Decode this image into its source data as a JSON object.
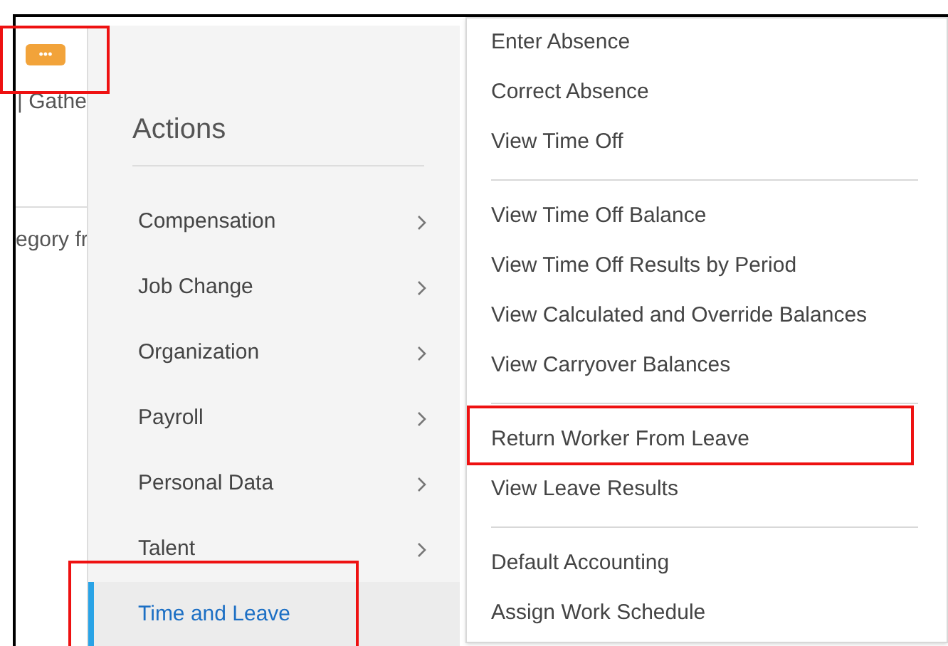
{
  "background": {
    "fragments": [
      "| Gathe",
      "egory fr"
    ]
  },
  "actions_button": {
    "label": "•••",
    "annotated": true
  },
  "actions_menu": {
    "title": "Actions",
    "items": [
      {
        "label": "Compensation",
        "selected": false,
        "annotated": false
      },
      {
        "label": "Job Change",
        "selected": false,
        "annotated": false
      },
      {
        "label": "Organization",
        "selected": false,
        "annotated": false
      },
      {
        "label": "Payroll",
        "selected": false,
        "annotated": false
      },
      {
        "label": "Personal Data",
        "selected": false,
        "annotated": false
      },
      {
        "label": "Talent",
        "selected": false,
        "annotated": false
      },
      {
        "label": "Time and Leave",
        "selected": true,
        "annotated": true
      }
    ]
  },
  "submenu": {
    "groups": [
      {
        "items": [
          {
            "label": "Enter Absence",
            "annotated": false
          },
          {
            "label": "Correct Absence",
            "annotated": false
          },
          {
            "label": "View Time Off",
            "annotated": false
          }
        ]
      },
      {
        "items": [
          {
            "label": "View Time Off Balance",
            "annotated": false
          },
          {
            "label": "View Time Off Results by Period",
            "annotated": false
          },
          {
            "label": "View Calculated and Override Balances",
            "annotated": false
          },
          {
            "label": "View Carryover Balances",
            "annotated": false
          }
        ]
      },
      {
        "items": [
          {
            "label": "Return Worker From Leave",
            "annotated": true
          },
          {
            "label": "View Leave Results",
            "annotated": false
          }
        ]
      },
      {
        "items": [
          {
            "label": "Default Accounting",
            "annotated": false
          },
          {
            "label": "Assign Work Schedule",
            "annotated": false
          }
        ]
      }
    ]
  }
}
